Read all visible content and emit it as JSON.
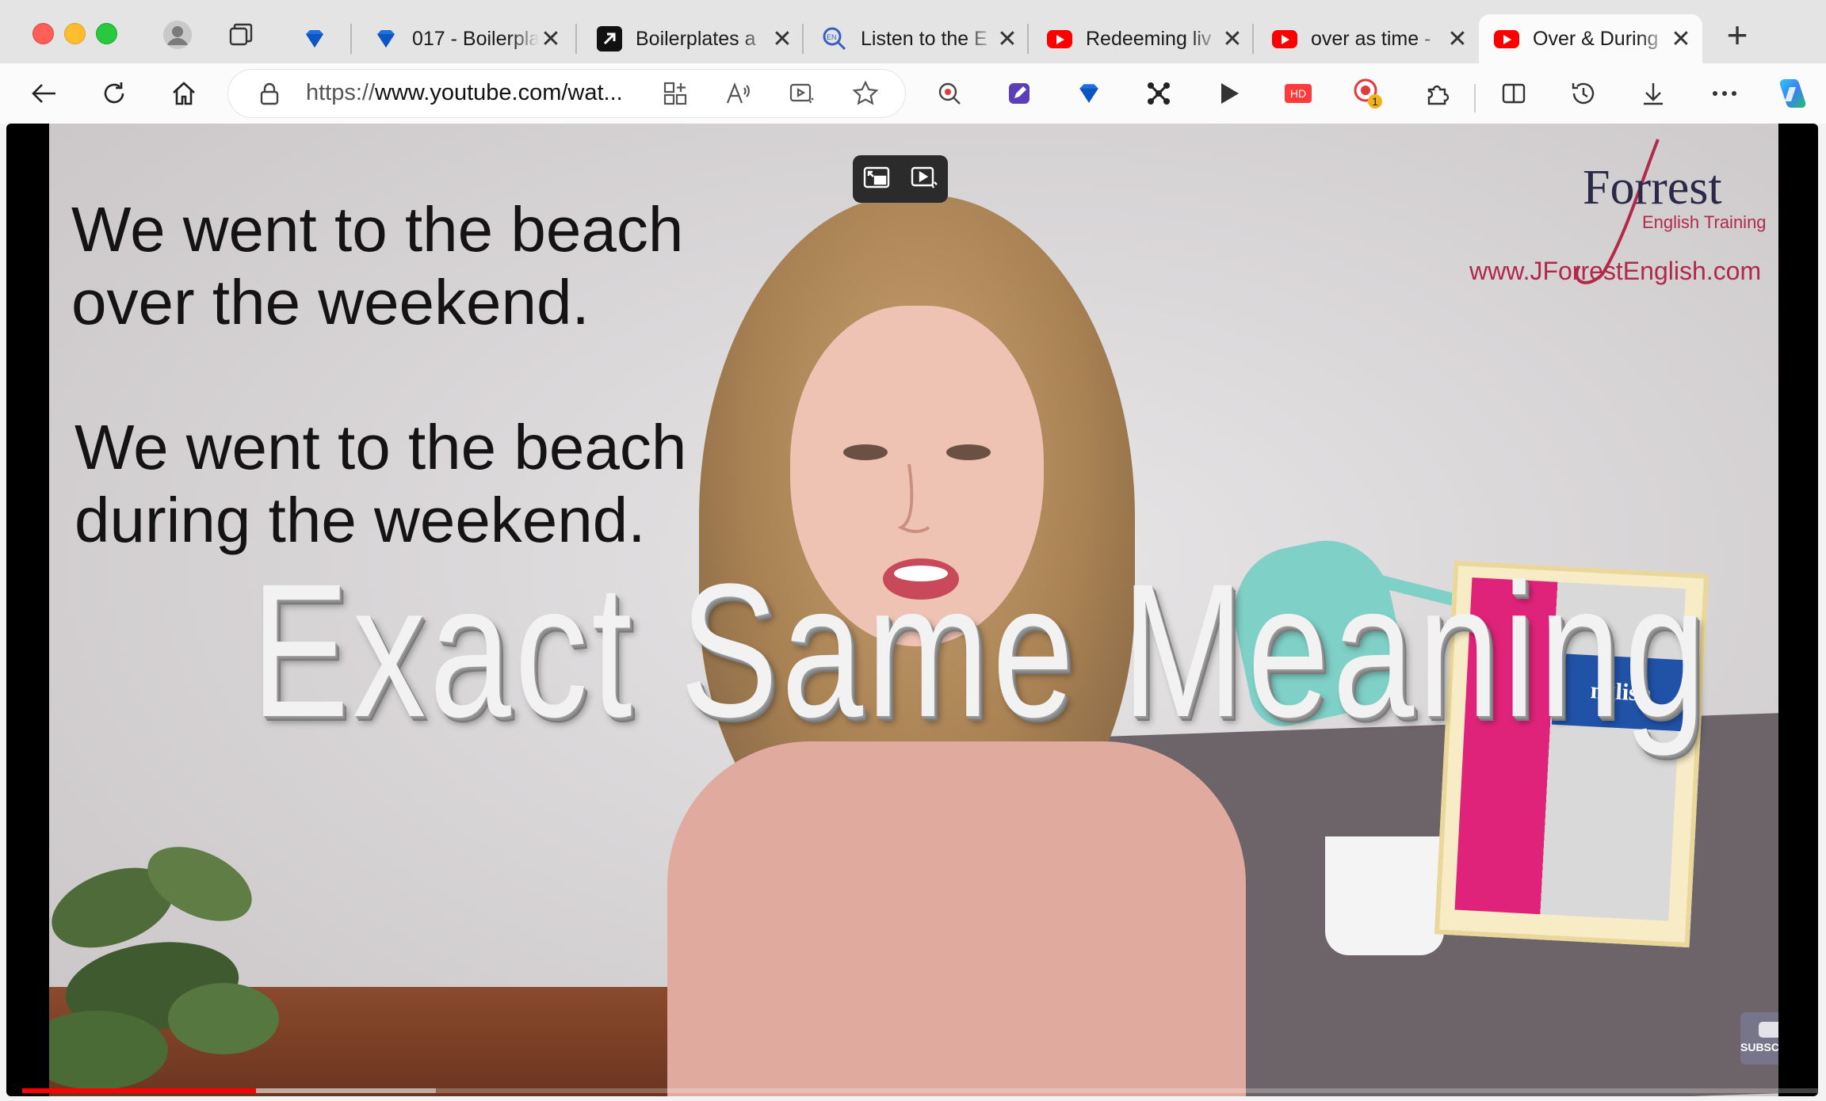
{
  "window": {
    "controls": [
      "close",
      "minimize",
      "zoom"
    ]
  },
  "tabs": [
    {
      "title": "",
      "icon": "gem-icon",
      "pinned": true
    },
    {
      "title": "017 - Boilerpla",
      "icon": "gem-icon"
    },
    {
      "title": "Boilerplates a",
      "icon": "arrow-icon"
    },
    {
      "title": "Listen to the E",
      "icon": "search-icon"
    },
    {
      "title": "Redeeming liv",
      "icon": "youtube-icon"
    },
    {
      "title": "over as time -",
      "icon": "youtube-icon"
    },
    {
      "title": "Over & During",
      "icon": "youtube-icon",
      "active": true
    }
  ],
  "toolbar": {
    "url_prefix": "https://",
    "url_host": "www.youtube.com/wat...",
    "extension_badge": "1",
    "hd_label": "HD"
  },
  "video": {
    "caption_1_line_1": "We went to the beach",
    "caption_1_line_2": "over the weekend.",
    "caption_2_line_1": "We went to the beach",
    "caption_2_line_2": "during the weekend.",
    "headline": "Exact Same Meaning",
    "logo_name": "Forrest",
    "logo_sub": "English Training",
    "website": "www.JForrestEnglish.com",
    "book_text": "nglish",
    "subscribe_watermark": "SUBSCRIBE",
    "progress_played": 0.13,
    "progress_buffered": 0.23
  },
  "colors": {
    "accent": "#ff0000",
    "brand": "#b0284a"
  }
}
